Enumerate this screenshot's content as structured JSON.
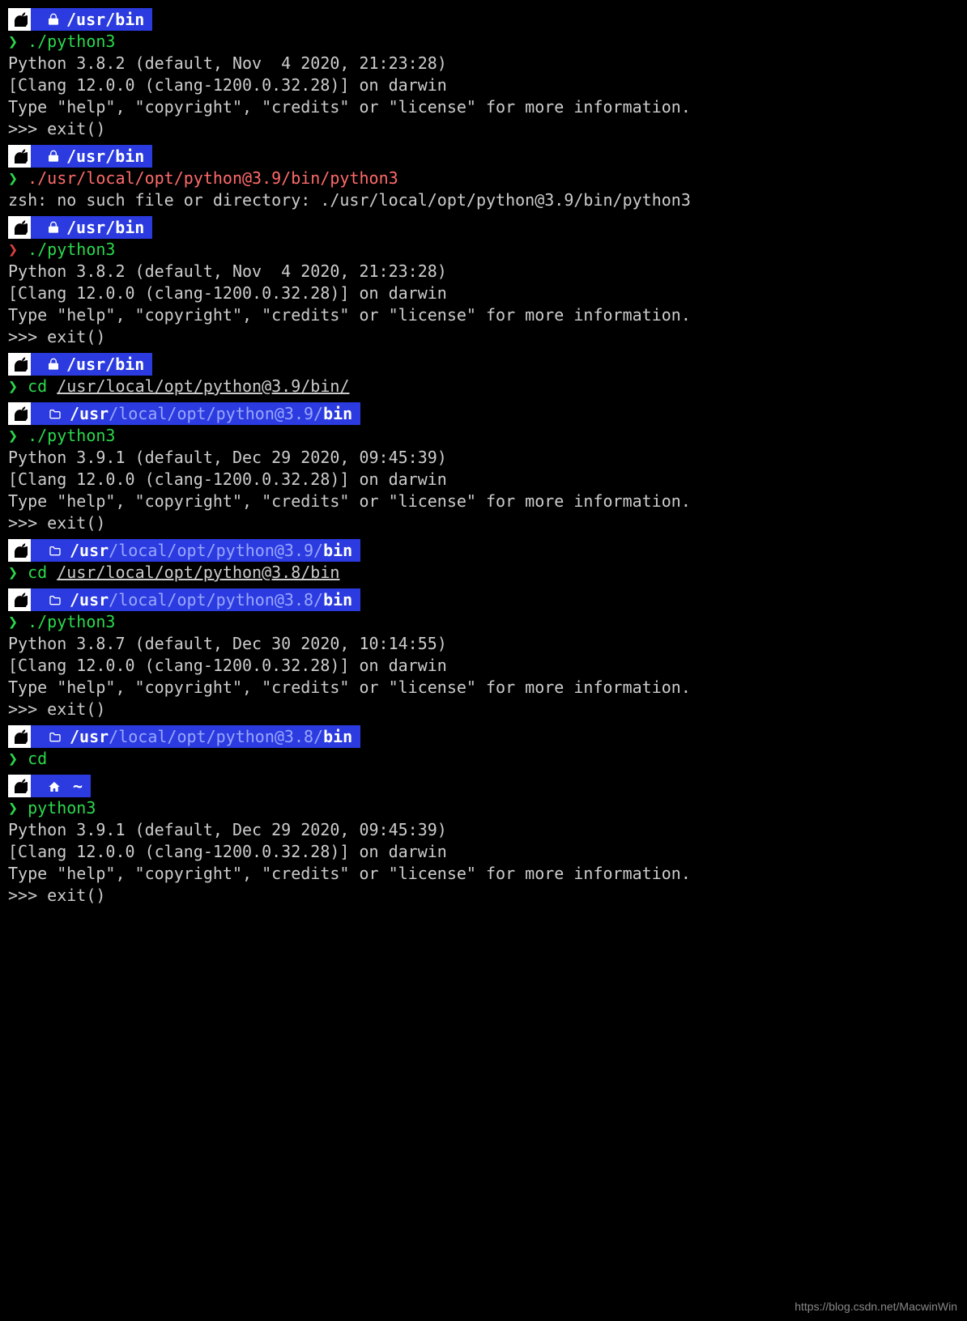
{
  "watermark": "https://blog.csdn.net/MacwinWin",
  "py382_banner": "Python 3.8.2 (default, Nov  4 2020, 21:23:28)\n[Clang 12.0.0 (clang-1200.0.32.28)] on darwin\nType \"help\", \"copyright\", \"credits\" or \"license\" for more information.\n>>> exit()",
  "py391_banner": "Python 3.9.1 (default, Dec 29 2020, 09:45:39)\n[Clang 12.0.0 (clang-1200.0.32.28)] on darwin\nType \"help\", \"copyright\", \"credits\" or \"license\" for more information.\n>>> exit()",
  "py387_banner": "Python 3.8.7 (default, Dec 30 2020, 10:14:55)\n[Clang 12.0.0 (clang-1200.0.32.28)] on darwin\nType \"help\", \"copyright\", \"credits\" or \"license\" for more information.\n>>> exit()",
  "zsh_err": "zsh: no such file or directory: ./usr/local/opt/python@3.9/bin/python3",
  "blocks": [
    {
      "dir_type": "lock",
      "dir_bold": "/usr/bin",
      "dir_dim": "",
      "arrow": "green",
      "cmd_class": "cmd",
      "cmd": "./python3",
      "arg": "",
      "arg_ul": false,
      "out_ref": "py382_banner"
    },
    {
      "dir_type": "lock",
      "dir_bold": "/usr/bin",
      "dir_dim": "",
      "arrow": "green",
      "cmd_class": "cmd err",
      "cmd": "./usr/local/opt/python@3.9/bin/python3",
      "arg": "",
      "arg_ul": false,
      "out_ref": "zsh_err"
    },
    {
      "dir_type": "lock",
      "dir_bold": "/usr/bin",
      "dir_dim": "",
      "arrow": "red",
      "cmd_class": "cmd",
      "cmd": "./python3",
      "arg": "",
      "arg_ul": false,
      "out_ref": "py382_banner"
    },
    {
      "dir_type": "lock",
      "dir_bold": "/usr/bin",
      "dir_dim": "",
      "arrow": "green",
      "cmd_class": "cmd",
      "cmd": "cd",
      "arg": "/usr/local/opt/python@3.9/bin/",
      "arg_ul": true,
      "out_ref": null
    },
    {
      "dir_type": "folder",
      "dir_bold_pre": "/usr",
      "dir_dim": "/local/opt/python@3.9/",
      "dir_bold_post": "bin",
      "arrow": "green",
      "cmd_class": "cmd",
      "cmd": "./python3",
      "arg": "",
      "arg_ul": false,
      "out_ref": "py391_banner"
    },
    {
      "dir_type": "folder",
      "dir_bold_pre": "/usr",
      "dir_dim": "/local/opt/python@3.9/",
      "dir_bold_post": "bin",
      "arrow": "green",
      "cmd_class": "cmd",
      "cmd": "cd",
      "arg": "/usr/local/opt/python@3.8/bin",
      "arg_ul": true,
      "out_ref": null
    },
    {
      "dir_type": "folder",
      "dir_bold_pre": "/usr",
      "dir_dim": "/local/opt/python@3.8/",
      "dir_bold_post": "bin",
      "arrow": "green",
      "cmd_class": "cmd",
      "cmd": "./python3",
      "arg": "",
      "arg_ul": false,
      "out_ref": "py387_banner"
    },
    {
      "dir_type": "folder",
      "dir_bold_pre": "/usr",
      "dir_dim": "/local/opt/python@3.8/",
      "dir_bold_post": "bin",
      "arrow": "green",
      "cmd_class": "cmd",
      "cmd": "cd",
      "arg": "",
      "arg_ul": false,
      "out_ref": null
    },
    {
      "dir_type": "home",
      "dir_bold": "~",
      "dir_dim": "",
      "arrow": "green",
      "cmd_class": "cmd",
      "cmd": "python3",
      "arg": "",
      "arg_ul": false,
      "out_ref": "py391_banner"
    }
  ]
}
